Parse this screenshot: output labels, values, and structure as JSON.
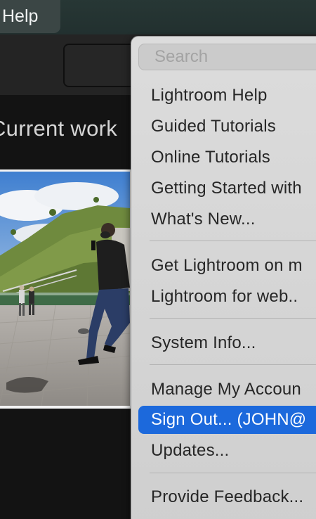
{
  "menubar": {
    "help_label": "Help"
  },
  "main": {
    "section_title": "Current work"
  },
  "help_menu": {
    "search_placeholder": "Search",
    "items": [
      {
        "label": "Lightroom Help"
      },
      {
        "label": "Guided Tutorials"
      },
      {
        "label": "Online Tutorials"
      },
      {
        "label": "Getting Started with"
      },
      {
        "label": "What's New..."
      },
      {
        "label": "Get Lightroom on m"
      },
      {
        "label": "Lightroom for web.."
      },
      {
        "label": "System Info..."
      },
      {
        "label": "Manage My Accoun"
      },
      {
        "label": "Sign Out... (JOHN@"
      },
      {
        "label": "Updates..."
      },
      {
        "label": "Provide Feedback..."
      }
    ],
    "selected_item": "Sign Out... (JOHN@"
  },
  "colors": {
    "menubar_bg": "#273735",
    "menu_highlight": "#1c69dc",
    "menu_bg": "#d8d8d8",
    "app_bg": "#131313"
  }
}
